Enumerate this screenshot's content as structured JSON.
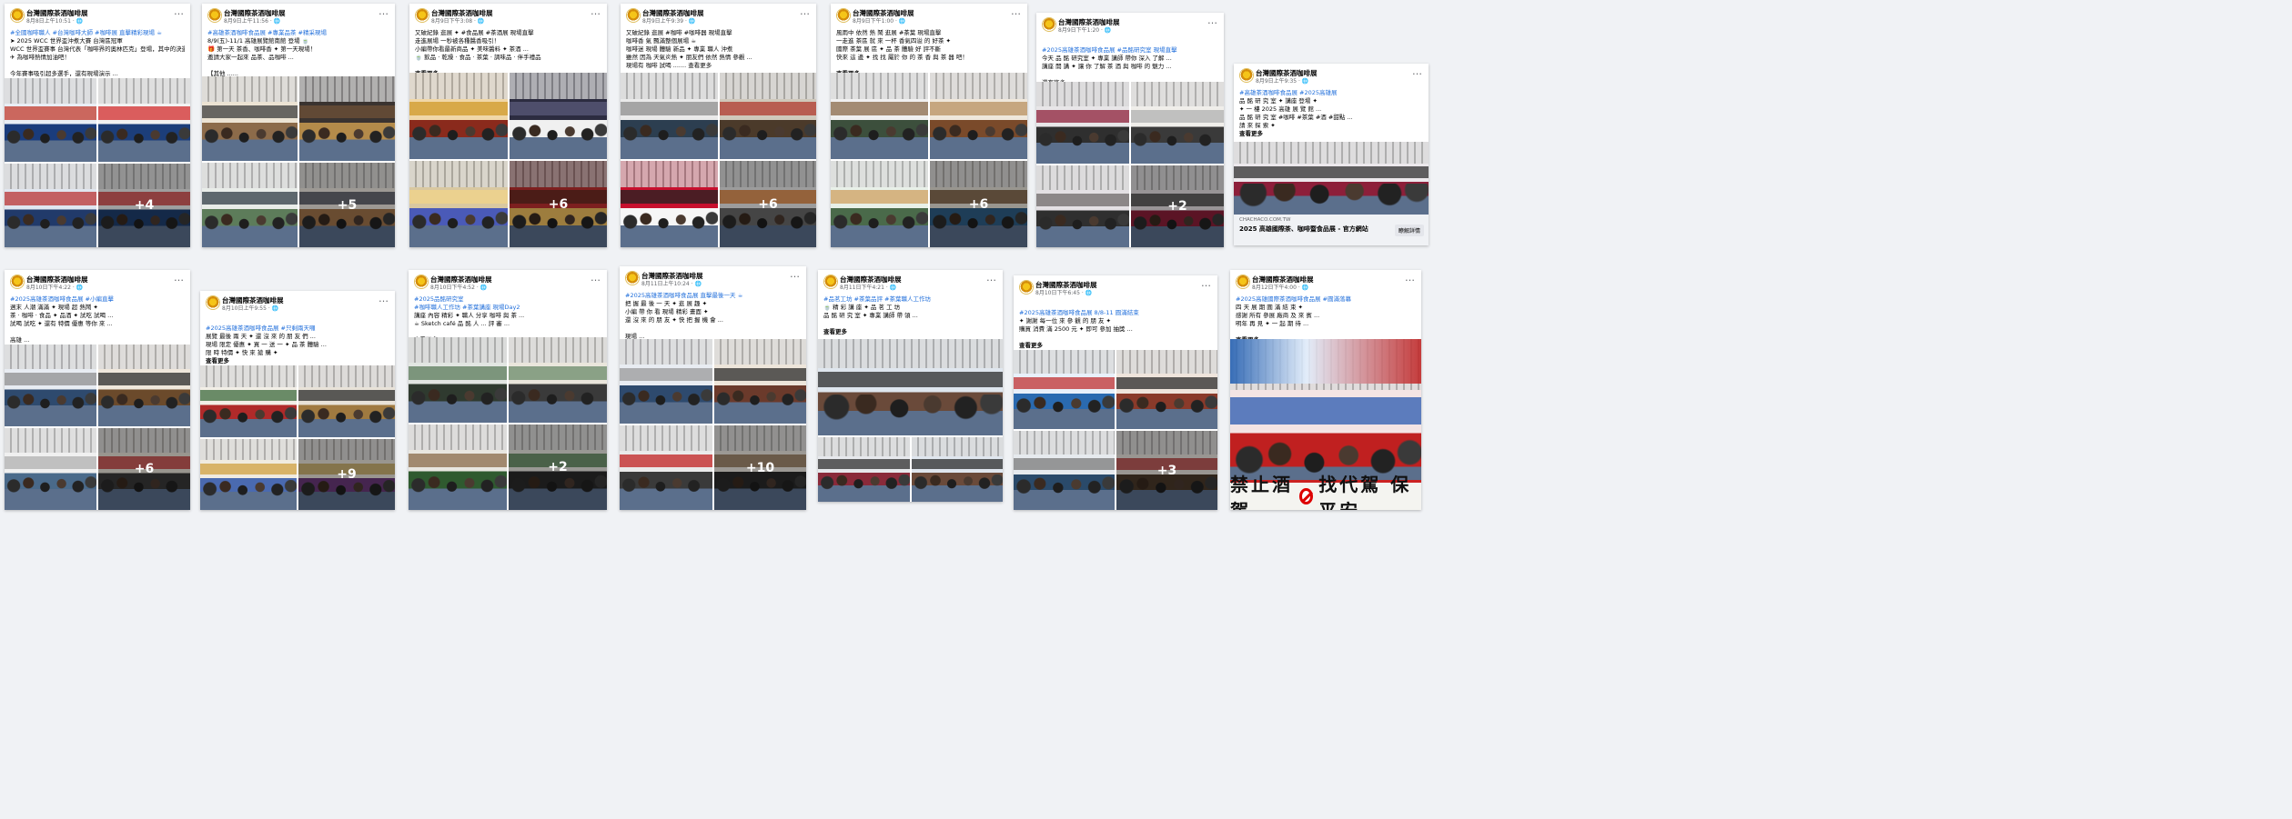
{
  "page": {
    "name": "台灣國際茶酒咖啡展"
  },
  "ui": {
    "more_icon": "…",
    "see_more": "查看更多"
  },
  "posts": [
    {
      "date": "8月8日上午10:51 · 🌐",
      "lines": [
        "#全國咖啡職人 #台灣咖啡大師 #咖啡展 直擊精彩現場 ☕",
        "➤ 2025 WCC 世界盃沖煮大賽 台灣區冠軍",
        "WCC 世界盃賽事 台灣代表「咖啡界的奧林匹克」登場，其中的決選 ...",
        "✈ 為咖啡熱情加油吧！",
        "",
        "今年賽事吸引超多選手，還有現場演示 ...",
        "來...",
        "查看更多"
      ],
      "overlay": "+4",
      "layout": "wcc"
    },
    {
      "date": "8月9日上午11:56 · 🌐",
      "lines": [
        "#高雄茶酒咖啡食品展 #專業品茶 #精采現場",
        "8/9(五)-11/1 高雄展覽館南館 登場 🍵",
        "🎁 第一天 茶香、咖啡香 ✦ 第一天現場！",
        "邀請大家一起來 品茶、品咖啡 ...",
        "",
        "【其他 ......",
        "查看更多"
      ],
      "overlay": "+5",
      "layout": "tasting"
    },
    {
      "date": "8月9日下午3:08 · 🌐",
      "lines": [
        "又破紀錄 逛展 ✦ #食品展 #茶酒展 現場直擊",
        "走進展場 一秒被各種醬香吸引！",
        "小編帶你看最新商品 ✦ 美味醬料 ✦ 茶酒 ...",
        "🍵 飲品 · 乾燥 · 食品 · 茶葉 · 調味品 · 伴手禮品",
        "",
        "查看更多"
      ],
      "overlay": "+6",
      "layout": "products"
    },
    {
      "date": "8月9日上午9:39 · 🌐",
      "lines": [
        "又破紀錄 逛展 #咖啡 #咖啡器 現場直擊",
        "咖啡香 氣 飄滿整個展場 ☕",
        "咖啡迷 現場 體驗 新品 ✦ 專業 職人 沖煮",
        "雖然 因為 天氣炎熱 ✦ 朋友們 依然 熱情 參觀 ...",
        "現場有 咖啡 試喝 ....... 查看更多"
      ],
      "overlay": "+6",
      "layout": "coffee"
    },
    {
      "date": "8月9日下午1:00 · 🌐",
      "lines": [
        "風雨中 依然 熱 鬧 逛展 #茶葉 現場直擊",
        "一走進 茶區 就 來 一杯 香氣四溢 的 好茶 ✦",
        "國際 茶葉 展 區 ✦ 品 茶 體驗 好 評不斷",
        "快來 這 邊 ✦ 找 找 屬於 你 的 茶 香 與 茶 器 吧！",
        "",
        "查看更多"
      ],
      "overlay": "+6",
      "layout": "tea"
    },
    {
      "date": "8月9日下午1:20 · 🌐",
      "lines": [
        "",
        "#2025高雄茶酒咖啡食品展 #品酩研究室 現場直擊",
        "今天 品 酩 研究室 ✦ 專業 講師 帶你 深入 了解 ...",
        "講座 開 講 ✦ 讓 你 了解 茶 酒 與 咖啡 的 魅力 ...",
        "",
        "還有許多 ......",
        "查看更多"
      ],
      "overlay": "+2",
      "layout": "seminar"
    },
    {
      "date": "8月9日上午9:35 · 🌐",
      "lines": [
        "#高雄茶酒咖啡食品展 #2025高雄展",
        "品 酩 研 究 室 ✦ 講座 登場 ✦",
        "✦ 一 樓 2025 高雄 展 覽 館 ...",
        "品 酩 研 究 室 #咖啡 #茶葉 #酒 #甜點 ...",
        "請 來 探 索 ✦",
        "查看更多"
      ],
      "overlay": "",
      "layout": "link",
      "link": {
        "site": "CHACHACO.COM.TW",
        "title": "2025 高雄國際茶、咖啡暨食品展 - 官方網站",
        "button": "瞭解詳情"
      }
    },
    {
      "date": "8月10日下午4:22 · 🌐",
      "lines": [
        "#2025高雄茶酒咖啡食品展 #小編直擊",
        "週末 人潮 滿滿 ✦ 現場 超 熱鬧 ✦",
        "茶 · 咖啡 · 食品 ✦ 品酒 ✦ 試吃 試喝 ...",
        "試喝 試吃 ✦ 還有 特價 優惠 等你 來 ...",
        "",
        "高雄 ...",
        "查看更多"
      ],
      "overlay": "+6",
      "layout": "crowd"
    },
    {
      "date": "8月10日上午9:55 · 🌐",
      "lines": [
        "",
        "#2025高雄茶酒咖啡食品展 #只剩兩天囉",
        "展覽 最後 兩 天 ✦ 還 沒 來 的 朋 友 們 ...",
        "現場 限定 優惠 ✦ 買 一 送 一 ✦ 品 茶 體驗 ...",
        "限 時 特價 ✦ 快 來 搶 購 ✦",
        "查看更多"
      ],
      "overlay": "+9",
      "layout": "promo"
    },
    {
      "date": "8月10日下午4:52 · 🌐",
      "lines": [
        "#2025品酩研究室",
        "#咖啡職人工作坊 #茶葉講座 現場Day2",
        "講座 內容 精彩 ✦ 職人 分享 咖啡 與 茶 ...",
        "☕ Sketch café 品 酩 人 ... 評 審 ...",
        "",
        "查看更多"
      ],
      "overlay": "+2",
      "layout": "workshop"
    },
    {
      "date": "8月11日上午10:24 · 🌐",
      "lines": [
        "#2025高雄茶酒咖啡食品展 直擊最後一天 ☕",
        "把 握 最 後 一 天 ✦ 逛 展 趣 ✦",
        "小編 帶 你 看 現場 精彩 畫面 ✦",
        "還 沒 來 的 朋 友 ✦ 快 把 握 機 會 ...",
        "",
        "現場 ...",
        "查看更多"
      ],
      "overlay": "+10",
      "layout": "lastday"
    },
    {
      "date": "8月11日下午4:21 · 🌐",
      "lines": [
        "#品茗工坊 #茶葉品評 #茶葉職人工作坊",
        "🍵 精 彩 講 座 ✦ 品 茗 工 坊",
        "品 酩 研 究 室 ✦ 專業 講師 帶 領 ...",
        "",
        "查看更多"
      ],
      "overlay": "",
      "layout": "hall"
    },
    {
      "date": "8月10日下午6:45 · 🌐",
      "lines": [
        "",
        "#2025高雄茶酒咖啡食品展 8/8-11 圓滿結束",
        "✦ 謝謝 每一位 來 參 觀 的 朋 友 ✦",
        "購買 消費 滿 2500 元 ✦ 即可 參加 抽獎 ...",
        "",
        "查看更多"
      ],
      "overlay": "+3",
      "layout": "booth"
    },
    {
      "date": "8月12日下午4:00 · 🌐",
      "lines": [
        "#2025高雄國際茶酒咖啡食品展 #圓滿落幕",
        "四 天 展 期 圓 滿 結 束 ✦",
        "感謝 所有 參展 廠商 及 來 賓 ...",
        "明年 再 見 ✦ 一 起 期 待 ...",
        "",
        "查看更多"
      ],
      "overlay": "",
      "layout": "group",
      "sign": "禁止酒駕 找代駕 保平安"
    }
  ]
}
